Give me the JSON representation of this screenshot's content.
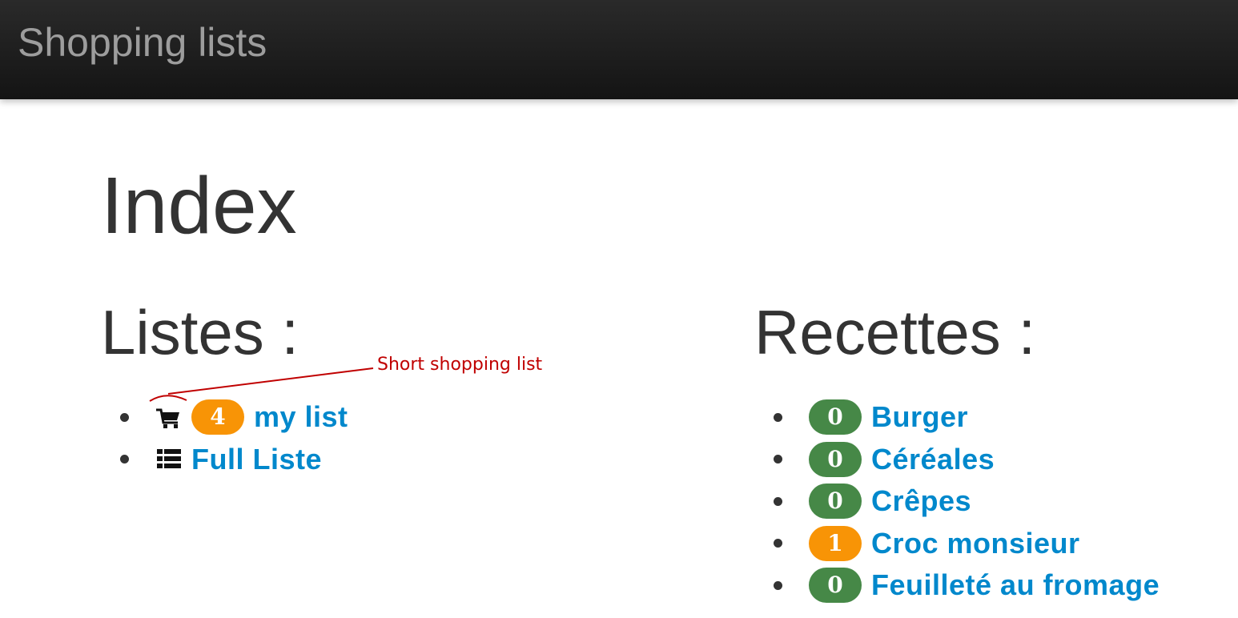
{
  "navbar": {
    "brand": "Shopping lists"
  },
  "page": {
    "title": "Index"
  },
  "lists_section": {
    "title": "Listes :",
    "items": [
      {
        "icon": "shopping-cart-icon",
        "badge": "4",
        "badge_color": "#f89406",
        "label": "my list"
      },
      {
        "icon": "list-icon",
        "label": "Full Liste"
      }
    ]
  },
  "recipes_section": {
    "title": "Recettes :",
    "items": [
      {
        "badge": "0",
        "badge_color": "#468847",
        "label": "Burger"
      },
      {
        "badge": "0",
        "badge_color": "#468847",
        "label": "Céréales"
      },
      {
        "badge": "0",
        "badge_color": "#468847",
        "label": "Crêpes"
      },
      {
        "badge": "1",
        "badge_color": "#f89406",
        "label": "Croc monsieur"
      },
      {
        "badge": "0",
        "badge_color": "#468847",
        "label": "Feuilleté au fromage"
      }
    ]
  },
  "annotation": {
    "text": "Short shopping list",
    "color": "#c00000"
  },
  "colors": {
    "link": "#0088cc",
    "heading": "#333333",
    "navbar": "#1b1b1b"
  }
}
